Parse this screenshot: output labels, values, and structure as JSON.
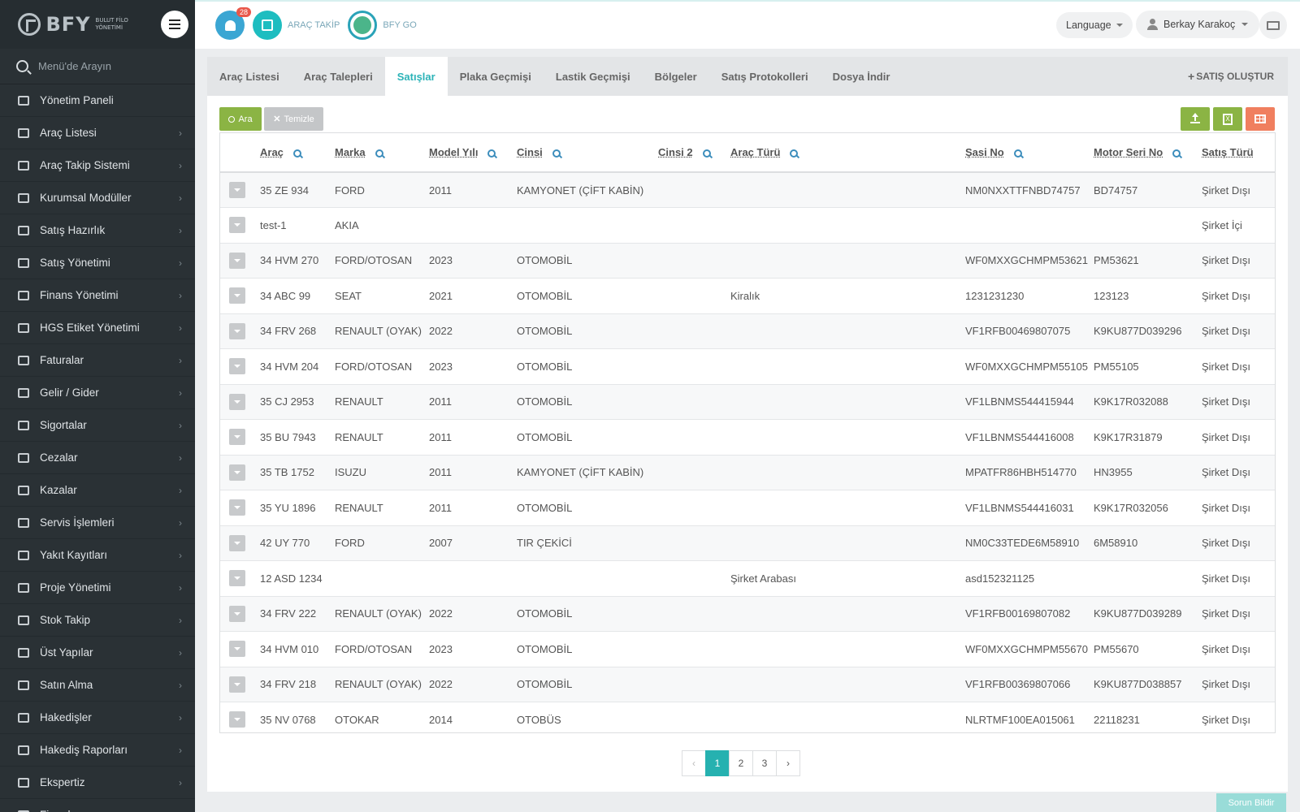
{
  "logo": {
    "text": "BFY",
    "subtitle": "BULUT FİLO YÖNETİMİ"
  },
  "sidebar": {
    "search_placeholder": "Menü'de Arayın",
    "items": [
      {
        "label": "Yönetim Paneli",
        "icon": "dashboard-icon",
        "has_arrow": false
      },
      {
        "label": "Araç Listesi",
        "icon": "bus-icon",
        "has_arrow": true
      },
      {
        "label": "Araç Takip Sistemi",
        "icon": "map-pin-icon",
        "has_arrow": true
      },
      {
        "label": "Kurumsal Modüller",
        "icon": "server-icon",
        "has_arrow": true
      },
      {
        "label": "Satış Hazırlık",
        "icon": "book-icon",
        "has_arrow": true
      },
      {
        "label": "Satış Yönetimi",
        "icon": "credit-card-icon",
        "has_arrow": true
      },
      {
        "label": "Finans Yönetimi",
        "icon": "money-icon",
        "has_arrow": true
      },
      {
        "label": "HGS Etiket Yönetimi",
        "icon": "tags-icon",
        "has_arrow": true
      },
      {
        "label": "Faturalar",
        "icon": "file-icon",
        "has_arrow": true
      },
      {
        "label": "Gelir / Gider",
        "icon": "cash-icon",
        "has_arrow": true
      },
      {
        "label": "Sigortalar",
        "icon": "umbrella-icon",
        "has_arrow": true
      },
      {
        "label": "Cezalar",
        "icon": "times-circle-icon",
        "has_arrow": true
      },
      {
        "label": "Kazalar",
        "icon": "car-crash-icon",
        "has_arrow": true
      },
      {
        "label": "Servis İşlemleri",
        "icon": "check-circle-icon",
        "has_arrow": true
      },
      {
        "label": "Yakıt Kayıtları",
        "icon": "gas-pump-icon",
        "has_arrow": true
      },
      {
        "label": "Proje Yönetimi",
        "icon": "briefcase-icon",
        "has_arrow": true
      },
      {
        "label": "Stok Takip",
        "icon": "inbox-icon",
        "has_arrow": true
      },
      {
        "label": "Üst Yapılar",
        "icon": "truck-icon",
        "has_arrow": true
      },
      {
        "label": "Satın Alma",
        "icon": "credit-card-icon",
        "has_arrow": true
      },
      {
        "label": "Hakedişler",
        "icon": "truck-icon",
        "has_arrow": true
      },
      {
        "label": "Hakediş Raporları",
        "icon": "truck-icon",
        "has_arrow": true
      },
      {
        "label": "Ekspertiz",
        "icon": "list-alt-icon",
        "has_arrow": true
      },
      {
        "label": "Firmalar",
        "icon": "building-icon",
        "has_arrow": true
      }
    ]
  },
  "topbar": {
    "notification_count": "28",
    "arac_takip_label": "ARAÇ TAKİP",
    "bfy_go_label": "BFY GO",
    "language_label": "Language",
    "user_name": "Berkay Karakoç"
  },
  "tabs": [
    {
      "label": "Araç Listesi",
      "active": false
    },
    {
      "label": "Araç Talepleri",
      "active": false
    },
    {
      "label": "Satışlar",
      "active": true
    },
    {
      "label": "Plaka Geçmişi",
      "active": false
    },
    {
      "label": "Lastik Geçmişi",
      "active": false
    },
    {
      "label": "Bölgeler",
      "active": false
    },
    {
      "label": "Satış Protokolleri",
      "active": false
    },
    {
      "label": "Dosya İndir",
      "active": false
    }
  ],
  "create_sale_label": "SATIŞ OLUŞTUR",
  "toolbar": {
    "search_label": "Ara",
    "clear_label": "Temizle"
  },
  "table": {
    "columns": [
      "Araç",
      "Marka",
      "Model Yılı",
      "Cinsi",
      "Cinsi 2",
      "Araç Türü",
      "Şasi No",
      "Motor Seri No",
      "Satış Türü"
    ],
    "rows": [
      [
        "35 ZE 934",
        "FORD",
        "2011",
        "KAMYONET (ÇİFT KABİN)",
        "",
        "",
        "NM0NXXTTFNBD74757",
        "BD74757",
        "Şirket Dışı"
      ],
      [
        "test-1",
        "AKIA",
        "",
        "",
        "",
        "",
        "",
        "",
        "Şirket İçi"
      ],
      [
        "34 HVM 270",
        "FORD/OTOSAN",
        "2023",
        "OTOMOBİL",
        "",
        "",
        "WF0MXXGCHMPM53621",
        "PM53621",
        "Şirket Dışı"
      ],
      [
        "34 ABC 99",
        "SEAT",
        "2021",
        "OTOMOBİL",
        "",
        "Kiralık",
        "1231231230",
        "123123",
        "Şirket Dışı"
      ],
      [
        "34 FRV 268",
        "RENAULT (OYAK)",
        "2022",
        "OTOMOBİL",
        "",
        "",
        "VF1RFB00469807075",
        "K9KU877D039296",
        "Şirket Dışı"
      ],
      [
        "34 HVM 204",
        "FORD/OTOSAN",
        "2023",
        "OTOMOBİL",
        "",
        "",
        "WF0MXXGCHMPM55105",
        "PM55105",
        "Şirket Dışı"
      ],
      [
        "35 CJ 2953",
        "RENAULT",
        "2011",
        "OTOMOBİL",
        "",
        "",
        "VF1LBNMS544415944",
        "K9K17R032088",
        "Şirket Dışı"
      ],
      [
        "35 BU 7943",
        "RENAULT",
        "2011",
        "OTOMOBİL",
        "",
        "",
        "VF1LBNMS544416008",
        "K9K17R31879",
        "Şirket Dışı"
      ],
      [
        "35 TB 1752",
        "ISUZU",
        "2011",
        "KAMYONET (ÇİFT KABİN)",
        "",
        "",
        "MPATFR86HBH514770",
        "HN3955",
        "Şirket Dışı"
      ],
      [
        "35 YU 1896",
        "RENAULT",
        "2011",
        "OTOMOBİL",
        "",
        "",
        "VF1LBNMS544416031",
        "K9K17R032056",
        "Şirket Dışı"
      ],
      [
        "42 UY 770",
        "FORD",
        "2007",
        "TIR ÇEKİCİ",
        "",
        "",
        "NM0C33TEDE6M58910",
        "6M58910",
        "Şirket Dışı"
      ],
      [
        "12 ASD 1234",
        "",
        "",
        "",
        "",
        "Şirket Arabası",
        "asd152321125",
        "",
        "Şirket Dışı"
      ],
      [
        "34 FRV 222",
        "RENAULT (OYAK)",
        "2022",
        "OTOMOBİL",
        "",
        "",
        "VF1RFB00169807082",
        "K9KU877D039289",
        "Şirket Dışı"
      ],
      [
        "34 HVM 010",
        "FORD/OTOSAN",
        "2023",
        "OTOMOBİL",
        "",
        "",
        "WF0MXXGCHMPM55670",
        "PM55670",
        "Şirket Dışı"
      ],
      [
        "34 FRV 218",
        "RENAULT (OYAK)",
        "2022",
        "OTOMOBİL",
        "",
        "",
        "VF1RFB00369807066",
        "K9KU877D038857",
        "Şirket Dışı"
      ],
      [
        "35 NV 0768",
        "OTOKAR",
        "2014",
        "OTOBÜS",
        "",
        "",
        "NLRTMF100EA015061",
        "22118231",
        "Şirket Dışı"
      ]
    ]
  },
  "pagination": {
    "prev": "‹",
    "next": "›",
    "pages": [
      "1",
      "2",
      "3"
    ],
    "current": "1"
  },
  "report_button": "Sorun Bildir",
  "colors": {
    "accent": "#2cb3b8",
    "sidebar_bg": "#2a3135",
    "green": "#8bb444",
    "orange": "#f07f5f"
  }
}
